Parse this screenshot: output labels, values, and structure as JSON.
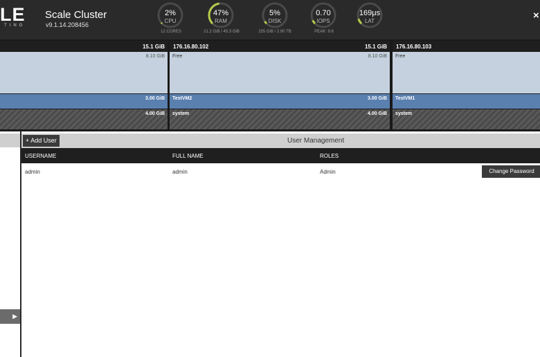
{
  "header": {
    "logo_text": "LE",
    "logo_sub": "TING",
    "cluster_title": "Scale Cluster",
    "version": "v9.1.14.208456",
    "gauges": [
      {
        "value": "2%",
        "label": "CPU",
        "sub": "12 CORES",
        "fraction": 0.02
      },
      {
        "value": "47%",
        "label": "RAM",
        "sub": "21.2 GiB / 45.3 GiB",
        "fraction": 0.47
      },
      {
        "value": "5%",
        "label": "DISK",
        "sub": "155 GiB / 2.90 TB",
        "fraction": 0.05
      },
      {
        "value": "0.70",
        "label": "IOPS",
        "sub": "PEAK: 9.6",
        "fraction": 0.07
      },
      {
        "value": "169μs",
        "label": "LAT",
        "sub": "",
        "fraction": 0.1
      }
    ],
    "gauge_color": "#b5cc4a",
    "close_icon": "close-icon"
  },
  "nodes": [
    {
      "ip": "",
      "total": "15.1 GiB",
      "free_label": "",
      "free_amount": "8.10 GiB",
      "vm_label": "",
      "vm_amount": "3.00 GiB",
      "sys_label": "",
      "sys_amount": "4.00 GiB"
    },
    {
      "ip": "176.16.80.102",
      "total": "15.1 GiB",
      "free_label": "Free",
      "free_amount": "8.10 GiB",
      "vm_label": "TestVM2",
      "vm_amount": "3.00 GiB",
      "sys_label": "system",
      "sys_amount": "4.00 GiB"
    },
    {
      "ip": "176.16.80.103",
      "total": "",
      "free_label": "Free",
      "free_amount": "",
      "vm_label": "TestVM1",
      "vm_amount": "",
      "sys_label": "system",
      "sys_amount": ""
    }
  ],
  "user_management": {
    "add_user_label": "+ Add User",
    "title": "User Management",
    "columns": [
      "USERNAME",
      "FULL NAME",
      "ROLES"
    ],
    "rows": [
      {
        "username": "admin",
        "full_name": "admin",
        "roles": "Admin",
        "action": "Change Password"
      }
    ]
  },
  "sidebar": {
    "toggle_icon": "play-arrow-icon"
  },
  "colors": {
    "header_bg": "#2a2a2a",
    "free_bg": "#c5d1de",
    "vm_bg": "#5a80b0",
    "accent": "#b5cc4a"
  }
}
